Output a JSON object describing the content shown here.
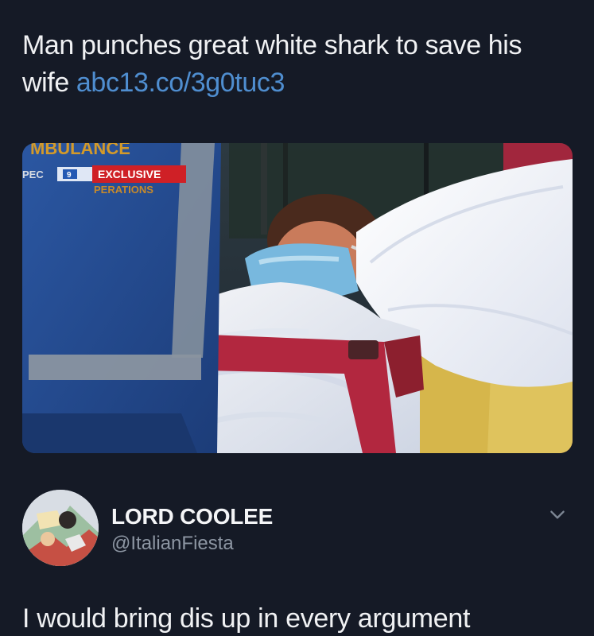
{
  "tweet": {
    "text": "Man punches great white shark to save his wife",
    "link": "abc13.co/3g0tuc3"
  },
  "media": {
    "top_text": "MBULANCE",
    "partial_label": "PEC",
    "channel_badge": "9",
    "exclusive_label": "EXCLUSIVE",
    "bottom_text": "PERATIONS"
  },
  "reply": {
    "user_name": "LORD COOLEE",
    "user_handle": "@ItalianFiesta",
    "text": "I would bring dis up in every argument"
  },
  "colors": {
    "background": "#151a26",
    "link": "#4f8ed0",
    "mask": "#78b8de",
    "stretcher_red": "#b2273f",
    "blanket_white": "#eef0f5",
    "yellow": "#d6b64b"
  },
  "icons": {
    "options": "chevron-down-icon"
  }
}
